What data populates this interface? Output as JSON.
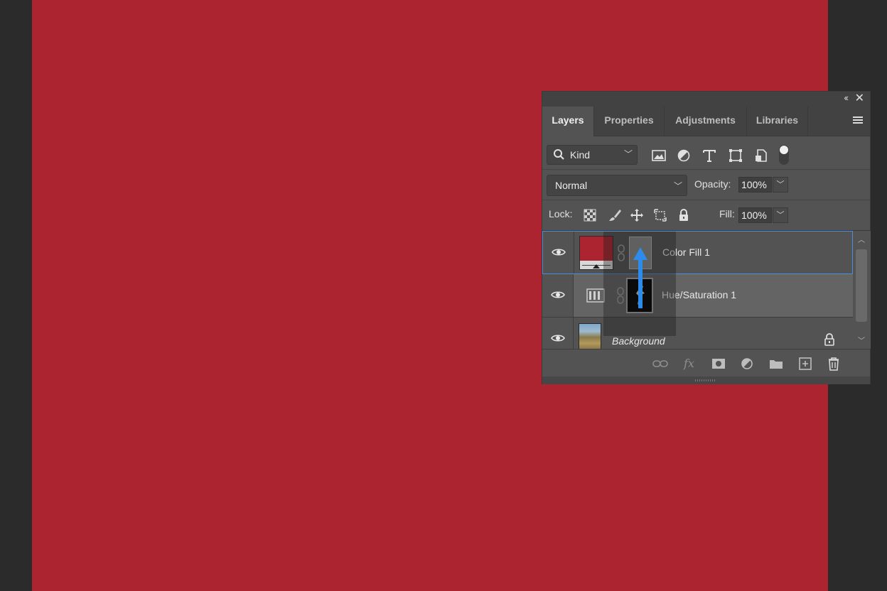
{
  "panel": {
    "tabs": [
      {
        "label": "Layers",
        "active": true
      },
      {
        "label": "Properties",
        "active": false
      },
      {
        "label": "Adjustments",
        "active": false
      },
      {
        "label": "Libraries",
        "active": false
      }
    ],
    "collapse_glyph": "‹‹",
    "close_glyph": "✕"
  },
  "filter": {
    "kind_label": "Kind",
    "icons": [
      "image-filter-icon",
      "adjustment-filter-icon",
      "type-filter-icon",
      "shape-filter-icon",
      "smart-object-filter-icon"
    ]
  },
  "blend": {
    "mode": "Normal",
    "opacity_label": "Opacity:",
    "opacity_value": "100%"
  },
  "lock": {
    "label": "Lock:",
    "fill_label": "Fill:",
    "fill_value": "100%"
  },
  "layers": [
    {
      "name": "Color Fill 1",
      "selected": true,
      "fill_color": "#ab2430"
    },
    {
      "name": "Hue/Saturation 1",
      "selected": false
    },
    {
      "name": "Background",
      "selected": false,
      "italic": true,
      "locked": true
    }
  ],
  "colors": {
    "canvas": "#ab2430",
    "workspace": "#2b2b2b",
    "panel": "#535353",
    "selection_border": "#4b8fdb",
    "drag_arrow": "#2d8ceb"
  }
}
